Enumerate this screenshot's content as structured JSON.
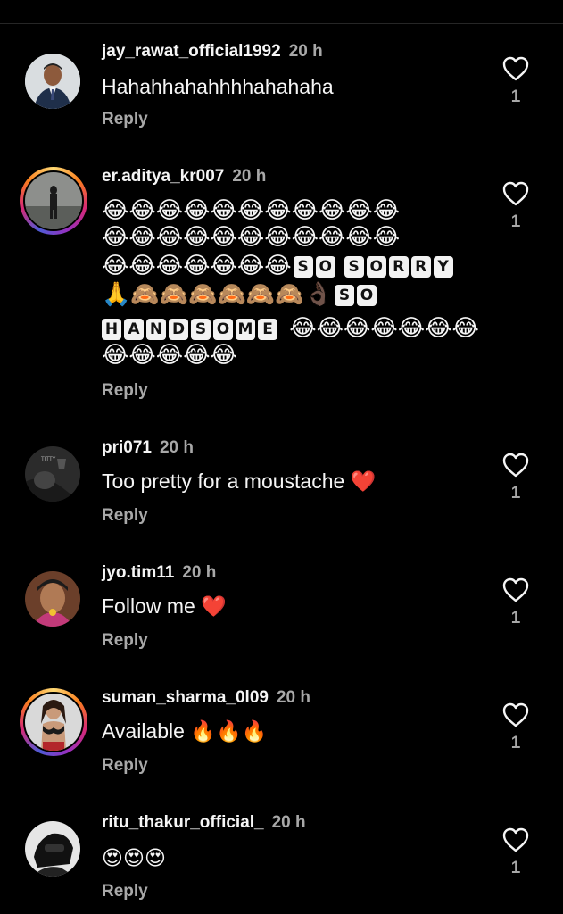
{
  "comments": [
    {
      "username": "jay_rawat_official1992",
      "time": "20 h",
      "text": "Hahahhahahhhhahahaha",
      "reply_label": "Reply",
      "likes": "1"
    },
    {
      "username": "er.aditya_kr007",
      "time": "20 h",
      "lines": [
        "😂😂😂😂😂😂😂😂😂😂😂",
        "😂😂😂😂😂😂😂😂😂😂😂",
        "😂😂😂😂😂😂😂",
        "🙏🙈🙈🙈🙈🙈🙈👌🏿",
        "😂😂😂😂😂😂😂",
        "😂😂😂😂😂"
      ],
      "boxed_1": [
        "S",
        "O",
        " ",
        "S",
        "O",
        "R",
        "R",
        "Y"
      ],
      "boxed_2": [
        "S",
        "O"
      ],
      "boxed_3": [
        "H",
        "A",
        "N",
        "D",
        "S",
        "O",
        "M",
        "E"
      ],
      "reply_label": "Reply",
      "likes": "1"
    },
    {
      "username": "pri071",
      "time": "20 h",
      "text": "Too pretty for a moustache ❤️",
      "reply_label": "Reply",
      "likes": "1"
    },
    {
      "username": "jyo.tim11",
      "time": "20 h",
      "text": "Follow me ❤️",
      "reply_label": "Reply",
      "likes": "1"
    },
    {
      "username": "suman_sharma_0l09",
      "time": "20 h",
      "text": "Available 🔥🔥🔥",
      "reply_label": "Reply",
      "likes": "1"
    },
    {
      "username": "ritu_thakur_official_",
      "time": "20 h",
      "text": "😍😍😍",
      "reply_label": "Reply",
      "likes": "1"
    }
  ],
  "icons": {
    "like": "heart-outline-icon"
  },
  "colors": {
    "background": "#000000",
    "text": "#f5f5f5",
    "secondary": "#a8a8a8"
  }
}
